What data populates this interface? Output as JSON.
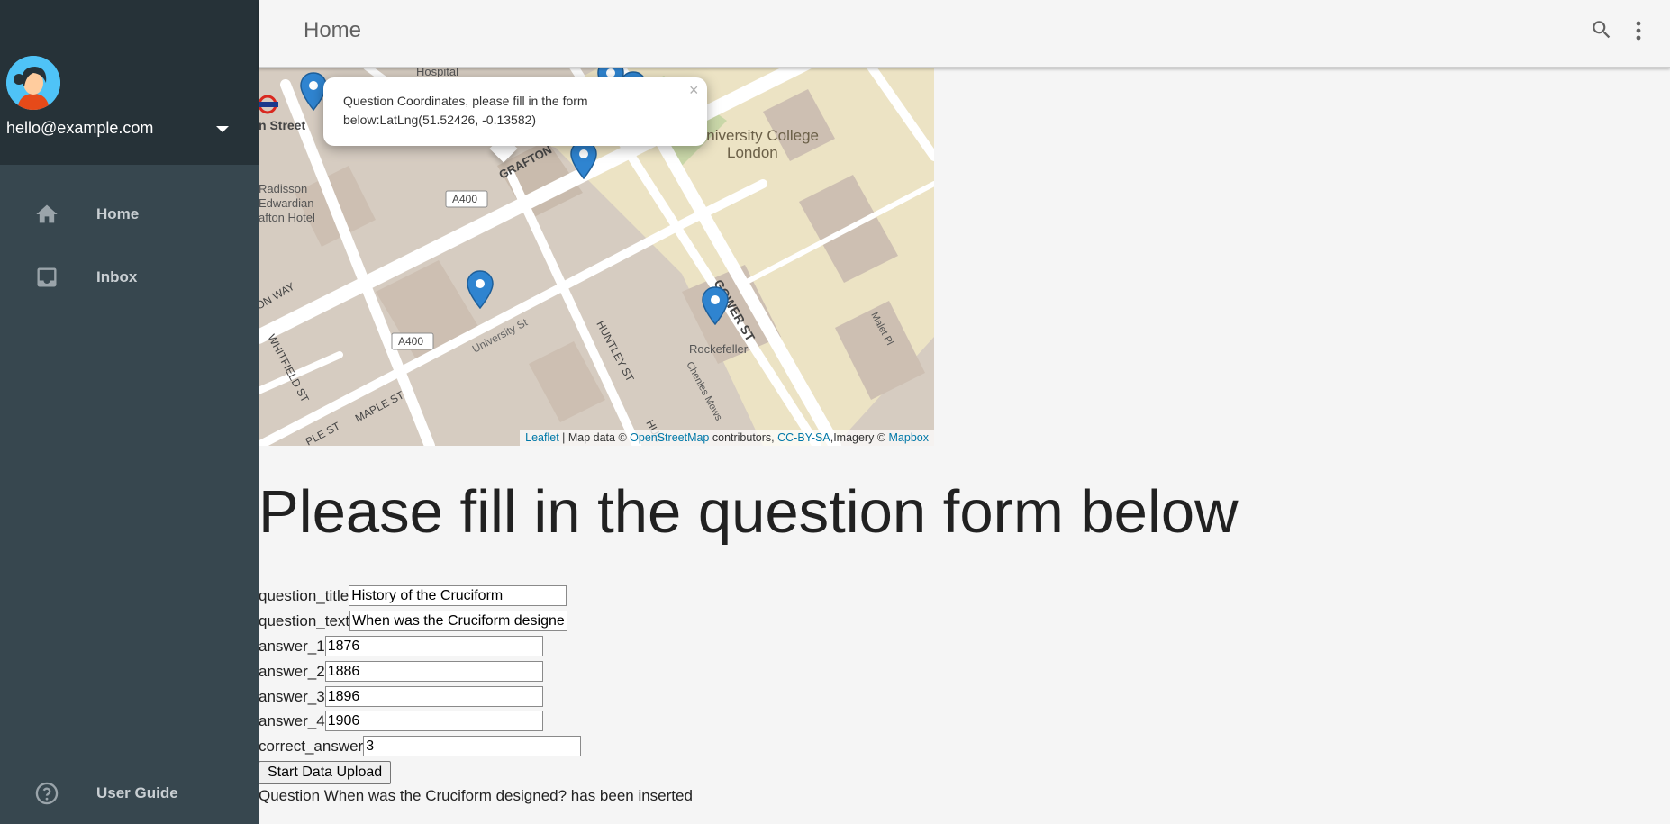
{
  "sidebar": {
    "account_email": "hello@example.com",
    "nav": [
      {
        "label": "Home",
        "icon": "home-icon"
      },
      {
        "label": "Inbox",
        "icon": "inbox-icon"
      }
    ],
    "footer": {
      "label": "User Guide",
      "icon": "help-icon"
    }
  },
  "header": {
    "title": "Home",
    "icons": [
      "search-icon",
      "more-vert-icon"
    ]
  },
  "map": {
    "popup_text": "Question Coordinates, please fill in the form below:LatLng(51.52426, -0.13582)",
    "popup_close": "×",
    "labels": {
      "hospital": "Hospital",
      "street_fragment": "n Street",
      "ucl": "University College",
      "london": "London",
      "grafton": "GRAFTON",
      "a400_top": "A400",
      "a400_bottom": "A400",
      "hotel_1": "Radisson",
      "hotel_2": "Edwardian",
      "hotel_3": "afton Hotel",
      "ton_way": "ON WAY",
      "whitfield": "WHITFIELD ST",
      "maple": "MAPLE ST",
      "ple_st": "PLE ST",
      "university_st": "University St",
      "huntley": "HUNTLEY ST",
      "hun": "HUN",
      "gower": "GOWER ST",
      "rockefeller": "Rockefeller",
      "chenies": "Chenies Mews",
      "malet": "Malet Pl"
    },
    "attribution": {
      "leaflet": "Leaflet",
      "sep": " | Map data © ",
      "osm": "OpenStreetMap",
      "contributors": " contributors, ",
      "ccbysa": "CC-BY-SA",
      "imagery": ",Imagery © ",
      "mapbox": "Mapbox"
    },
    "colors": {
      "marker": "#2f84d0",
      "land": "#d6ccc1",
      "campus": "#ece3c4",
      "road": "#ffffff"
    }
  },
  "form": {
    "heading": "Please fill in the question form below",
    "fields": [
      {
        "label": "question_title",
        "value": "History of the Cruciform"
      },
      {
        "label": "question_text",
        "value": "When was the Cruciform designed?"
      },
      {
        "label": "answer_1",
        "value": "1876"
      },
      {
        "label": "answer_2",
        "value": "1886"
      },
      {
        "label": "answer_3",
        "value": "1896"
      },
      {
        "label": "answer_4",
        "value": "1906"
      },
      {
        "label": "correct_answer",
        "value": "3"
      }
    ],
    "upload_button": "Start Data Upload",
    "status": "Question When was the Cruciform designed? has been inserted"
  }
}
